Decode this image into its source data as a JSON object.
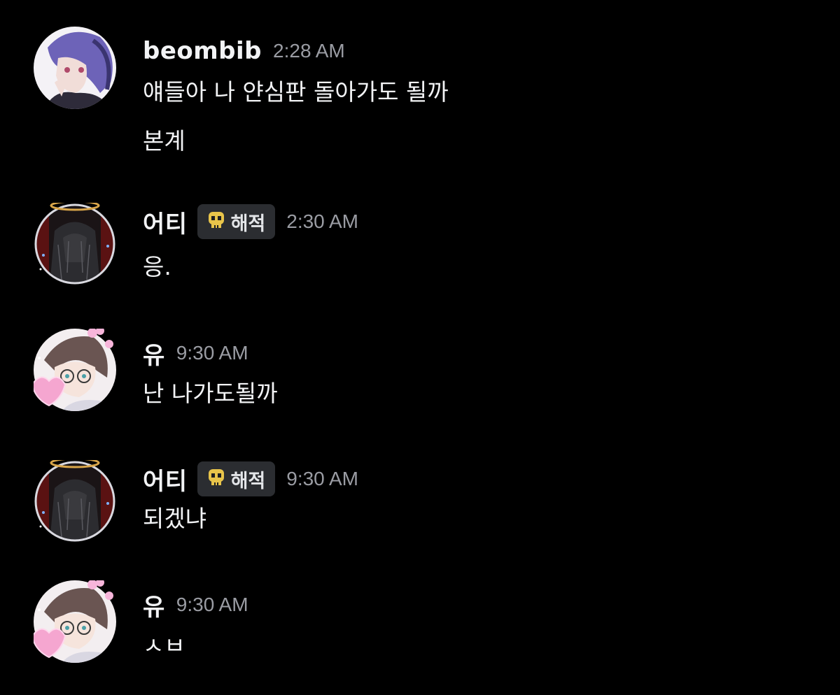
{
  "colors": {
    "background": "#000000",
    "username": "#f2f3f5",
    "timestamp": "#9a9ca3",
    "tag_bg": "#2b2d31",
    "message_text": "#f2f3f5"
  },
  "messages": [
    {
      "username": "beombib",
      "tag": null,
      "time": "2:28 AM",
      "avatar_icon": "purple-hair-avatar-icon",
      "lines": [
        "얘들아 나 얀심판 돌아가도 될까",
        "본계"
      ]
    },
    {
      "username": "어티",
      "tag": {
        "icon": "skull-icon",
        "label": "해적"
      },
      "time": "2:30 AM",
      "avatar_icon": "dark-halo-avatar-icon",
      "lines": [
        "응."
      ]
    },
    {
      "username": "유",
      "tag": null,
      "time": "9:30 AM",
      "avatar_icon": "glasses-boy-avatar-icon",
      "lines": [
        "난 나가도될까"
      ]
    },
    {
      "username": "어티",
      "tag": {
        "icon": "skull-icon",
        "label": "해적"
      },
      "time": "9:30 AM",
      "avatar_icon": "dark-halo-avatar-icon",
      "lines": [
        "되겠냐"
      ]
    },
    {
      "username": "유",
      "tag": null,
      "time": "9:30 AM",
      "avatar_icon": "glasses-boy-avatar-icon",
      "lines": [
        "ㅅㅂ"
      ]
    }
  ]
}
